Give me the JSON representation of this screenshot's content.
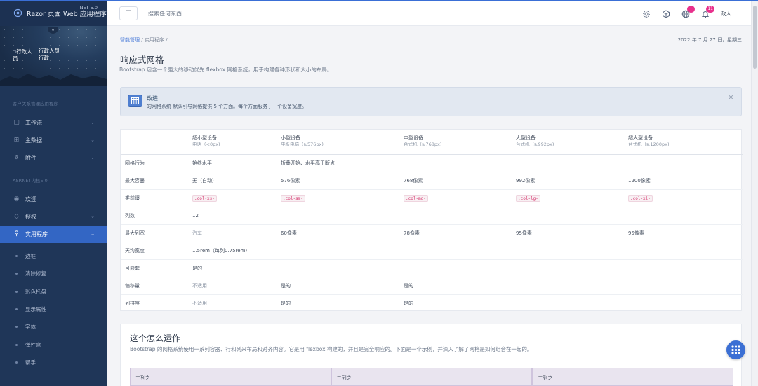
{
  "app": {
    "name": "Razor 页面 Web 应用程序",
    "version": ".NET 5.0",
    "toggle_glyph": "⌄",
    "avatar_alt": "行政人员",
    "user_name": "行政人员",
    "user_role": "行政"
  },
  "colors": {
    "accent": "#3366c4",
    "sidebar_bg": "#1f3658",
    "badge": "#e8308c",
    "code": "#d6336c"
  },
  "sidebar": {
    "section1": "客户关系管理应用程序",
    "items1": [
      {
        "label": "工作流",
        "icon": "workflow-icon"
      },
      {
        "label": "主数据",
        "icon": "database-icon"
      },
      {
        "label": "附件",
        "icon": "paperclip-icon"
      }
    ],
    "section2": "ASP.NET内核5.0",
    "items2": [
      {
        "label": "欢迎",
        "icon": "eye-icon"
      },
      {
        "label": "授权",
        "icon": "shield-icon"
      },
      {
        "label": "实用程序",
        "icon": "bulb-icon"
      }
    ],
    "sub_items": [
      "边框",
      "清除修复",
      "彩色托盘",
      "显示属性",
      "字体",
      "弹性盒",
      "帮手"
    ]
  },
  "header": {
    "search_placeholder": "搜索任何东西",
    "badge1": "!",
    "badge2": "11",
    "user": "政人"
  },
  "breadcrumb": {
    "root": "智能管理",
    "sep": "/",
    "current": "实用程序",
    "sep2": "/"
  },
  "date": "2022 年 7 月 27 日，星期三",
  "page": {
    "title": "响应式网格",
    "desc": "Bootstrap 包含一个强大的移动优先 flexbox 网格系统，用于构建各种形状和大小的布局。"
  },
  "alert": {
    "title": "改进",
    "text": "的网格系统 默认引导网格提供 5 个方面。每个方面服务于一个设备宽度。",
    "close": "×"
  },
  "grid_table": {
    "headers": [
      {
        "title": "超小型设备",
        "sub": "电话（<0px)"
      },
      {
        "title": "小型设备",
        "sub": "平板电脑（≥576px)"
      },
      {
        "title": "中型设备",
        "sub": "台式机（≥768px)"
      },
      {
        "title": "大型设备",
        "sub": "台式机（≥992px)"
      },
      {
        "title": "超大型设备",
        "sub": "台式机（≥1200px)"
      }
    ],
    "rows": {
      "behavior": {
        "label": "网格行为",
        "xs": "始终水平",
        "sm": "折叠开始、水平高于断点"
      },
      "container": {
        "label": "最大容器",
        "values": [
          "无（自动）",
          "576像素",
          "768像素",
          "992像素",
          "1200像素"
        ]
      },
      "prefix": {
        "label": "类前缀",
        "values": [
          ".col-xs-",
          ".col-sm-",
          ".col-md-",
          ".col-lg-",
          ".col-xl-"
        ]
      },
      "columns": {
        "label": "列数",
        "value": "12"
      },
      "col_width": {
        "label": "最大列宽",
        "values": [
          "汽车",
          "60像素",
          "78像素",
          "95像素",
          "95像素"
        ]
      },
      "gutter": {
        "label": "天沟宽度",
        "value": "1.5rem（每列0.75rem)"
      },
      "nestable": {
        "label": "可嵌套",
        "value": "是的"
      },
      "offsets": {
        "label": "偏移量",
        "xs": "不适用",
        "sm": "是的",
        "md": "是的"
      },
      "order": {
        "label": "列排序",
        "xs": "不适用",
        "sm": "是的",
        "md": "是的"
      }
    }
  },
  "how": {
    "title": "这个怎么运作",
    "text": "Bootstrap 的网格系统使用一系列容器、行和列来布局和对齐内容。它是用 flexbox 构建的，并且是完全响应的。下面是一个示例，并深入了解了网格是如何组合在一起的。",
    "cols": [
      "三列之一",
      "三列之一",
      "三列之一"
    ]
  }
}
